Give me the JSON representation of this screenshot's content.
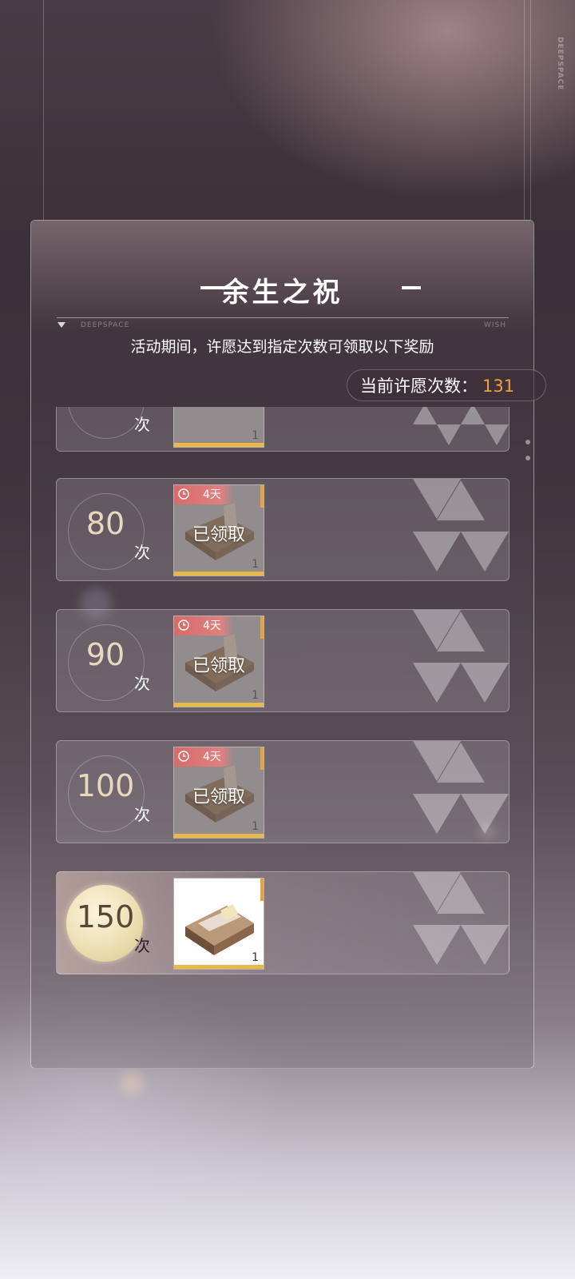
{
  "page": {
    "watermark": "DEEPSPACE",
    "title": "余生之祝",
    "header_left_label": "DEEPSPACE",
    "header_right_label": "WISH",
    "subtitle": "活动期间，许愿达到指定次数可领取以下奖励",
    "count_label": "当前许愿次数：",
    "count_value": "131"
  },
  "rewards": [
    {
      "goal": "",
      "unit": "次",
      "qty": "1",
      "timer": "",
      "status": "",
      "state": "partial"
    },
    {
      "goal": "80",
      "unit": "次",
      "qty": "1",
      "timer": "4天",
      "status": "已领取",
      "state": "claimed"
    },
    {
      "goal": "90",
      "unit": "次",
      "qty": "1",
      "timer": "4天",
      "status": "已领取",
      "state": "claimed"
    },
    {
      "goal": "100",
      "unit": "次",
      "qty": "1",
      "timer": "4天",
      "status": "已领取",
      "state": "claimed"
    },
    {
      "goal": "150",
      "unit": "次",
      "qty": "1",
      "timer": "",
      "status": "",
      "state": "available"
    }
  ],
  "icons": {
    "clock": "clock-icon",
    "reward": "gift-box-icon",
    "collapse": "triangle-down-icon"
  },
  "colors": {
    "count_accent": "#f0a040",
    "timer_red": "#d86a6a",
    "gold_frame": "#e8b84a"
  }
}
